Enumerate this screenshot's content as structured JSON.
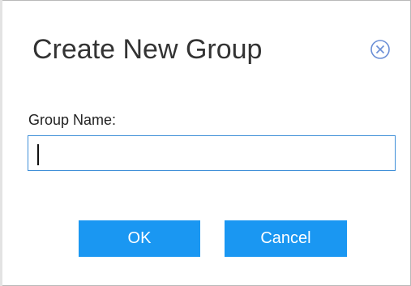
{
  "dialog": {
    "title": "Create New Group",
    "close_icon": "close-circle-icon",
    "field_label": "Group Name:",
    "group_name_value": "",
    "group_name_placeholder": "",
    "ok_label": "OK",
    "cancel_label": "Cancel"
  },
  "colors": {
    "accent": "#1a97f2",
    "input_border": "#3f8fd8",
    "close_icon": "#6b8fd6",
    "title_text": "#333333"
  }
}
